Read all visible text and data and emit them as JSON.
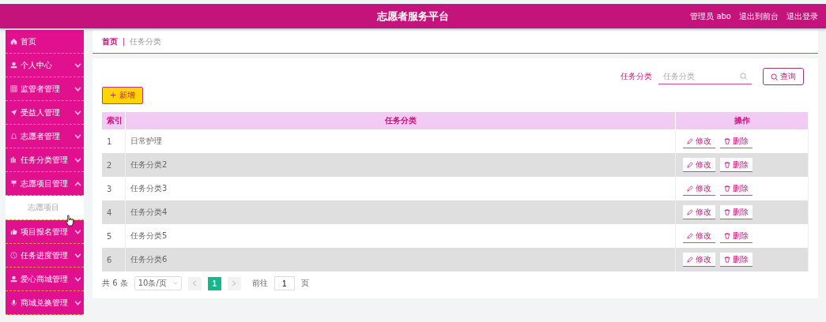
{
  "header": {
    "title": "志愿者服务平台",
    "user": "管理员 abo",
    "links": [
      "退出到前台",
      "退出登录"
    ]
  },
  "sidebar": {
    "items": [
      {
        "label": "首页",
        "kind": "link"
      },
      {
        "label": "个人中心",
        "kind": "menu",
        "expanded": false
      },
      {
        "label": "监管者管理",
        "kind": "menu",
        "expanded": false
      },
      {
        "label": "受益人管理",
        "kind": "menu",
        "expanded": false
      },
      {
        "label": "志愿者管理",
        "kind": "menu",
        "expanded": false
      },
      {
        "label": "任务分类管理",
        "kind": "menu",
        "expanded": false
      },
      {
        "label": "志愿项目管理",
        "kind": "menu",
        "expanded": true,
        "children": [
          {
            "label": "志愿项目"
          }
        ]
      },
      {
        "label": "项目报名管理",
        "kind": "menu",
        "expanded": false
      },
      {
        "label": "任务进度管理",
        "kind": "menu",
        "expanded": false
      },
      {
        "label": "爱心商城管理",
        "kind": "menu",
        "expanded": false
      },
      {
        "label": "商城兑换管理",
        "kind": "menu",
        "expanded": false
      }
    ]
  },
  "breadcrumb": {
    "items": [
      "首页",
      "任务分类"
    ],
    "separator": "|"
  },
  "search": {
    "label": "任务分类",
    "placeholder": "任务分类",
    "button": "查询"
  },
  "add_button": "+ 新增",
  "table": {
    "columns": [
      "索引",
      "任务分类",
      "操作"
    ],
    "rows": [
      {
        "index": "1",
        "name": "日常护理",
        "actions": [
          "修改",
          "删除"
        ]
      },
      {
        "index": "2",
        "name": "任务分类2",
        "actions": [
          "修改",
          "删除"
        ]
      },
      {
        "index": "3",
        "name": "任务分类3",
        "actions": [
          "修改",
          "删除"
        ]
      },
      {
        "index": "4",
        "name": "任务分类4",
        "actions": [
          "修改",
          "删除"
        ]
      },
      {
        "index": "5",
        "name": "任务分类5",
        "actions": [
          "修改",
          "删除"
        ]
      },
      {
        "index": "6",
        "name": "任务分类6",
        "actions": [
          "修改",
          "删除"
        ]
      }
    ]
  },
  "pagination": {
    "total": "共 6 条",
    "page_size": "10条/页",
    "pages": [
      {
        "label": "1",
        "selected": true
      }
    ],
    "goto_label": "前往",
    "goto_value": "1",
    "goto_suffix": "页"
  }
}
